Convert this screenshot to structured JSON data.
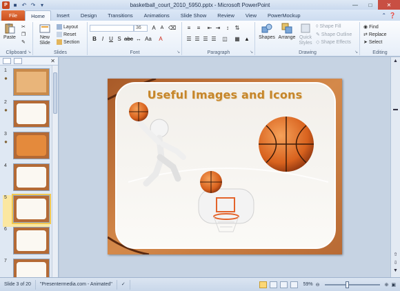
{
  "window": {
    "title": "basketball_court_2010_5950.pptx - Microsoft PowerPoint"
  },
  "tabs": [
    "File",
    "Home",
    "Insert",
    "Design",
    "Transitions",
    "Animations",
    "Slide Show",
    "Review",
    "View",
    "PowerMockup"
  ],
  "ribbon": {
    "clipboard": {
      "label": "Clipboard",
      "paste": "Paste"
    },
    "slides": {
      "label": "Slides",
      "new_slide": "New Slide",
      "layout": "Layout",
      "reset": "Reset",
      "section": "Section"
    },
    "font": {
      "label": "Font",
      "size": "36"
    },
    "paragraph": {
      "label": "Paragraph"
    },
    "drawing": {
      "label": "Drawing",
      "shapes": "Shapes",
      "arrange": "Arrange",
      "quick_styles": "Quick Styles",
      "shape_fill": "Shape Fill",
      "shape_outline": "Shape Outline",
      "shape_effects": "Shape Effects"
    },
    "editing": {
      "label": "Editing",
      "find": "Find",
      "replace": "Replace",
      "select": "Select"
    }
  },
  "thumbnails": [
    "1",
    "2",
    "3",
    "4",
    "5",
    "6",
    "7"
  ],
  "slide": {
    "title": "Useful Images and Icons"
  },
  "status": {
    "slide_info": "Slide 3 of 20",
    "theme": "\"Presentermedia.com - Animated\"",
    "zoom": "59%"
  },
  "colors": {
    "file_tab": "#d35a26",
    "title_text": "#c6862a",
    "selection": "#f2c74e"
  }
}
